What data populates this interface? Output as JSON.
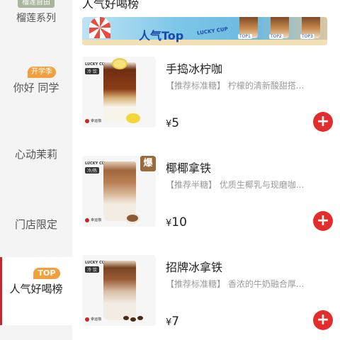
{
  "sidebar": {
    "categories": [
      {
        "badge": "榴莲自由",
        "label": "榴莲系列"
      },
      {
        "badge": "开学季",
        "label": "你好 同学"
      },
      {
        "badge": "",
        "label": "心动茉莉"
      },
      {
        "badge": "",
        "label": "门店限定"
      },
      {
        "badge": "TOP",
        "label": "人气好喝榜",
        "selected": true
      }
    ]
  },
  "main": {
    "section_title": "人气好喝榜",
    "banner": {
      "title": "人气Top",
      "brand": "LUCKY CUP",
      "ranks": [
        "TOP1",
        "TOP2",
        "TOP3"
      ]
    },
    "products": [
      {
        "name": "手捣冰柠咖",
        "desc": "【推荐标准糖】 柠檬的清新酸甜搭...",
        "price_symbol": "¥",
        "price": "5",
        "thumb_brand": "LUCKY CUP",
        "thumb_temp": "冷 饮",
        "thumb_store": "幸运咖",
        "hot_badge": ""
      },
      {
        "name": "椰椰拿铁",
        "desc": "【推荐半糖】 优质生椰乳与现磨咖...",
        "price_symbol": "¥",
        "price": "10",
        "thumb_brand": "LUCKY CUP",
        "thumb_temp": "冷/热",
        "thumb_store": "幸运咖",
        "hot_badge": "爆"
      },
      {
        "name": "招牌冰拿铁",
        "desc": "【推荐标准糖】 香浓的牛奶融合厚...",
        "price_symbol": "¥",
        "price": "7",
        "thumb_brand": "LUCKY CUP",
        "thumb_temp": "冷 饮",
        "thumb_store": "幸运咖",
        "hot_badge": ""
      }
    ],
    "add_icon": "plus-icon"
  },
  "colors": {
    "accent": "#e32d2d",
    "badge_orange": "#f2a03d",
    "sidebar_bg": "#f4f4f4",
    "selected_bar": "#c1272d"
  }
}
